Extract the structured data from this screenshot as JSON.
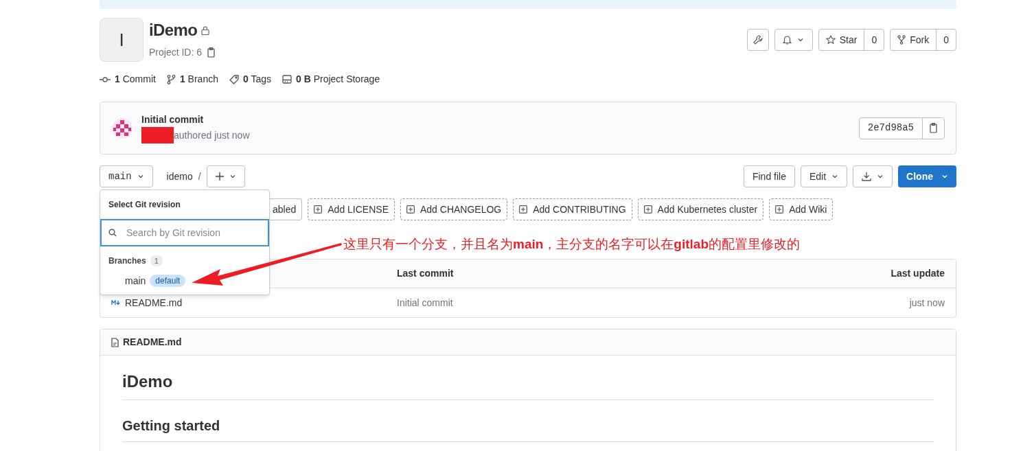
{
  "project": {
    "avatar_letter": "I",
    "name": "iDemo",
    "private": true,
    "project_id": "Project ID: 6"
  },
  "stats": [
    {
      "kind": "commit",
      "count": "1",
      "label": "Commit"
    },
    {
      "kind": "branch",
      "count": "1",
      "label": "Branch"
    },
    {
      "kind": "tag",
      "count": "0",
      "label": "Tags"
    },
    {
      "kind": "storage",
      "count": "0 B",
      "label": "Project Storage"
    }
  ],
  "actions": {
    "star": {
      "label": "Star",
      "count": "0"
    },
    "fork": {
      "label": "Fork",
      "count": "0"
    }
  },
  "last_commit": {
    "title": "Initial commit",
    "meta": "authored just now",
    "sha": "2e7d98a5"
  },
  "toolbar": {
    "branch": "main",
    "path": "idemo",
    "separator": "/",
    "find_file": "Find file",
    "edit": "Edit",
    "clone": "Clone"
  },
  "suggestions": [
    {
      "label": "abled",
      "dashed": false
    },
    {
      "label": "Add LICENSE",
      "dashed": true
    },
    {
      "label": "Add CHANGELOG",
      "dashed": true
    },
    {
      "label": "Add CONTRIBUTING",
      "dashed": true
    },
    {
      "label": "Add Kubernetes cluster",
      "dashed": true
    },
    {
      "label": "Add Wiki",
      "dashed": true
    }
  ],
  "dropdown": {
    "title": "Select Git revision",
    "search": {
      "placeholder": "Search by Git revision"
    },
    "section": "Branches",
    "section_count": "1",
    "items": [
      {
        "name": "main",
        "badge": "default"
      }
    ]
  },
  "table": {
    "columns": [
      "Last commit",
      "Last update"
    ],
    "rows": [
      {
        "name": "README.md",
        "commit": "Initial commit",
        "updated": "just now"
      }
    ]
  },
  "readme": {
    "file": "README.md",
    "headings": [
      "iDemo",
      "Getting started"
    ]
  },
  "annotation": "这里只有一个分支，并且名为**main**，主分支的名字可以在**gitlab**的配置里修改的"
}
